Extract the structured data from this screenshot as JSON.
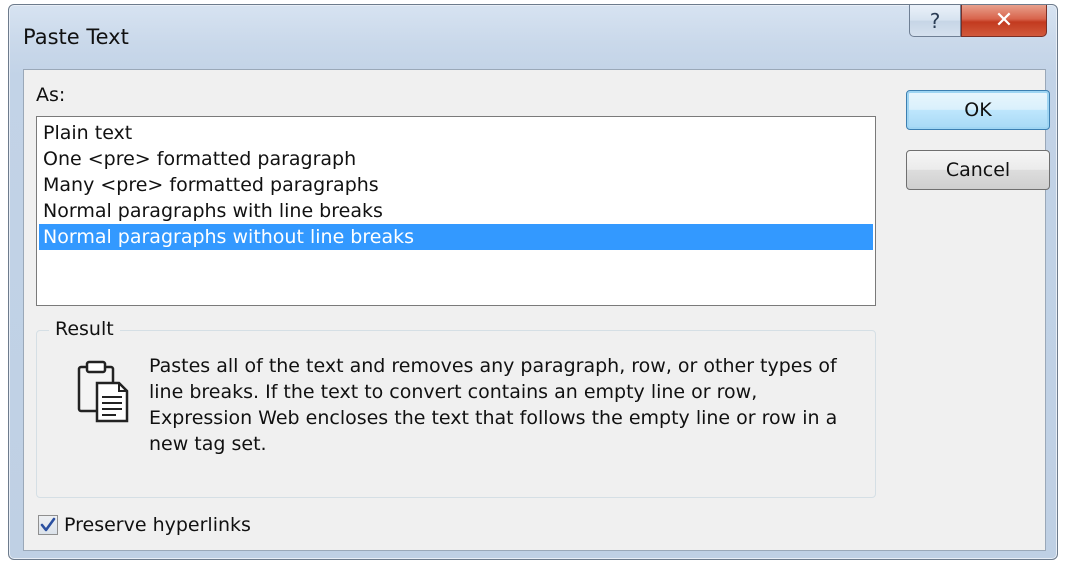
{
  "window": {
    "title": "Paste Text",
    "help_label": "?",
    "close_label": "✕"
  },
  "as_label": "As:",
  "options": [
    {
      "label": "Plain text",
      "selected": false
    },
    {
      "label": "One <pre> formatted paragraph",
      "selected": false
    },
    {
      "label": "Many <pre> formatted paragraphs",
      "selected": false
    },
    {
      "label": "Normal paragraphs with line breaks",
      "selected": false
    },
    {
      "label": "Normal paragraphs without line breaks",
      "selected": true
    }
  ],
  "buttons": {
    "ok_label": "OK",
    "cancel_label": "Cancel"
  },
  "result": {
    "legend": "Result",
    "icon": "paste-icon",
    "description": "Pastes all of the text and removes any paragraph, row, or other types of line breaks. If the text to convert contains an empty line or row, Expression Web encloses the text that follows the empty line or row in a new tag set."
  },
  "preserve_hyperlinks": {
    "label": "Preserve hyperlinks",
    "checked": true
  },
  "colors": {
    "selection": "#3399ff",
    "close_button": "#c23a1f"
  }
}
